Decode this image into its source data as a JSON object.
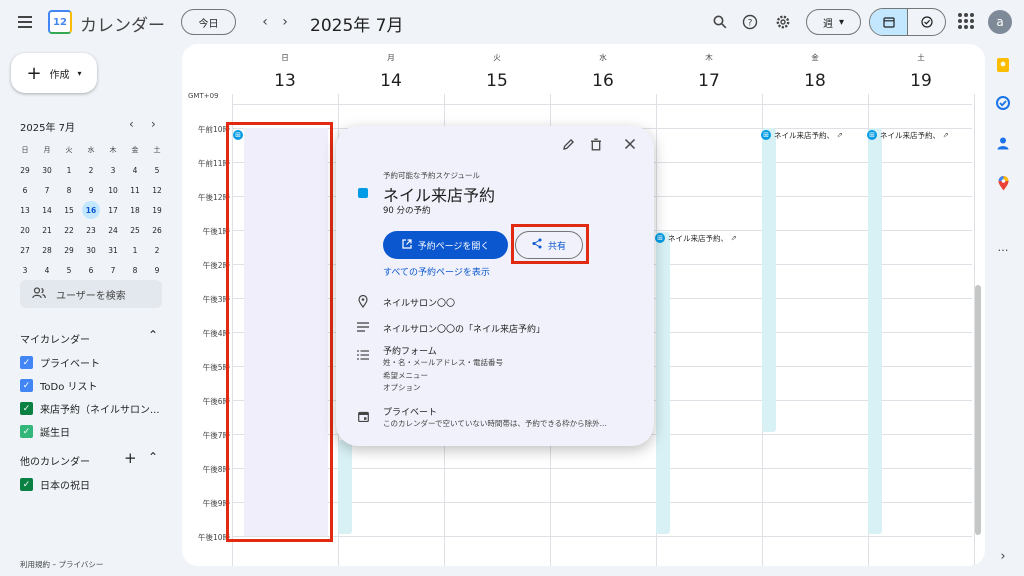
{
  "header": {
    "app_title": "カレンダー",
    "logo_day": "12",
    "today_label": "今日",
    "prev_arrow": "‹",
    "next_arrow": "›",
    "period_title": "2025年 7月",
    "view_label": "週",
    "avatar_letter": "a"
  },
  "sidebar": {
    "create_label": "作成",
    "mini_calendar": {
      "title": "2025年 7月",
      "weekdays": [
        "日",
        "月",
        "火",
        "水",
        "木",
        "金",
        "土"
      ],
      "weeks": [
        [
          "29",
          "30",
          "1",
          "2",
          "3",
          "4",
          "5"
        ],
        [
          "6",
          "7",
          "8",
          "9",
          "10",
          "11",
          "12"
        ],
        [
          "13",
          "14",
          "15",
          "16",
          "17",
          "18",
          "19"
        ],
        [
          "20",
          "21",
          "22",
          "23",
          "24",
          "25",
          "26"
        ],
        [
          "27",
          "28",
          "29",
          "30",
          "31",
          "1",
          "2"
        ],
        [
          "3",
          "4",
          "5",
          "6",
          "7",
          "8",
          "9"
        ]
      ],
      "selected_day": "16"
    },
    "people_search_label": "ユーザーを検索",
    "my_calendars_title": "マイカレンダー",
    "my_calendars": [
      {
        "label": "プライベート",
        "color": "#4285f4"
      },
      {
        "label": "ToDo リスト",
        "color": "#4285f4"
      },
      {
        "label": "来店予約（ネイルサロン...",
        "color": "#0b8043"
      },
      {
        "label": "誕生日",
        "color": "#33b679"
      }
    ],
    "other_calendars_title": "他のカレンダー",
    "other_calendars": [
      {
        "label": "日本の祝日",
        "color": "#0b8043"
      }
    ],
    "footer": "利用規約 – プライバシー"
  },
  "week": {
    "timezone": "GMT+09",
    "days": [
      {
        "dow": "日",
        "date": "13"
      },
      {
        "dow": "月",
        "date": "14"
      },
      {
        "dow": "火",
        "date": "15"
      },
      {
        "dow": "水",
        "date": "16"
      },
      {
        "dow": "木",
        "date": "17"
      },
      {
        "dow": "金",
        "date": "18"
      },
      {
        "dow": "土",
        "date": "19"
      }
    ],
    "hours": [
      "午前10時",
      "午前11時",
      "午後12時",
      "午後1時",
      "午後2時",
      "午後3時",
      "午後4時",
      "午後5時",
      "午後6時",
      "午後7時",
      "午後8時",
      "午後9時",
      "午後10時"
    ],
    "event_chip_label": "ネイル来店予約、",
    "event_chip_icon": "grid-icon"
  },
  "popup": {
    "kicker": "予約可能な予約スケジュール",
    "title": "ネイル来店予約",
    "duration": "90 分の予約",
    "open_page_label": "予約ページを開く",
    "share_label": "共有",
    "all_pages_link": "すべての予約ページを表示",
    "location": "ネイルサロン〇〇",
    "description": "ネイルサロン〇〇の「ネイル来店予約」",
    "form_title": "予約フォーム",
    "form_lines": [
      "姓・名・メールアドレス・電話番号",
      "希望メニュー",
      "オプション"
    ],
    "calendar_name": "プライベート",
    "calendar_note": "このカレンダーで空いていない時間帯は、予約できる枠から除外..."
  },
  "colors": {
    "accent": "#0b57d0",
    "highlight": "#e02a12",
    "slot_band": "#d8f1f5"
  }
}
